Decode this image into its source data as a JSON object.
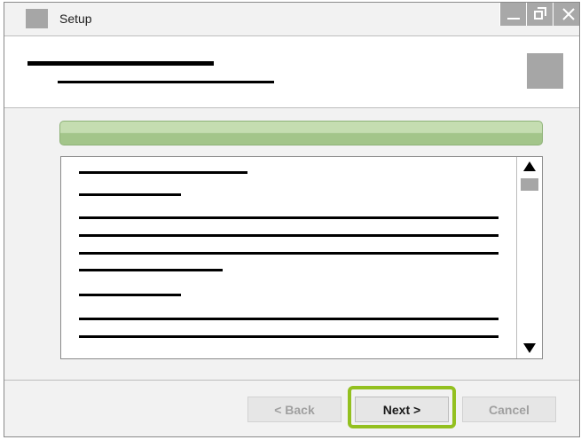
{
  "window": {
    "title": "Setup"
  },
  "progress": {
    "fraction": 1.0
  },
  "buttons": {
    "back_label": "< Back",
    "next_label": "Next >",
    "cancel_label": "Cancel"
  },
  "colors": {
    "highlight": "#93c01f",
    "progress": "#a3c58a"
  },
  "icons": {
    "app": "app-icon",
    "header": "header-icon",
    "minimize": "minimize-icon",
    "restore": "restore-icon",
    "close": "close-icon",
    "scroll_up": "arrow-up-icon",
    "scroll_down": "arrow-down-icon"
  }
}
